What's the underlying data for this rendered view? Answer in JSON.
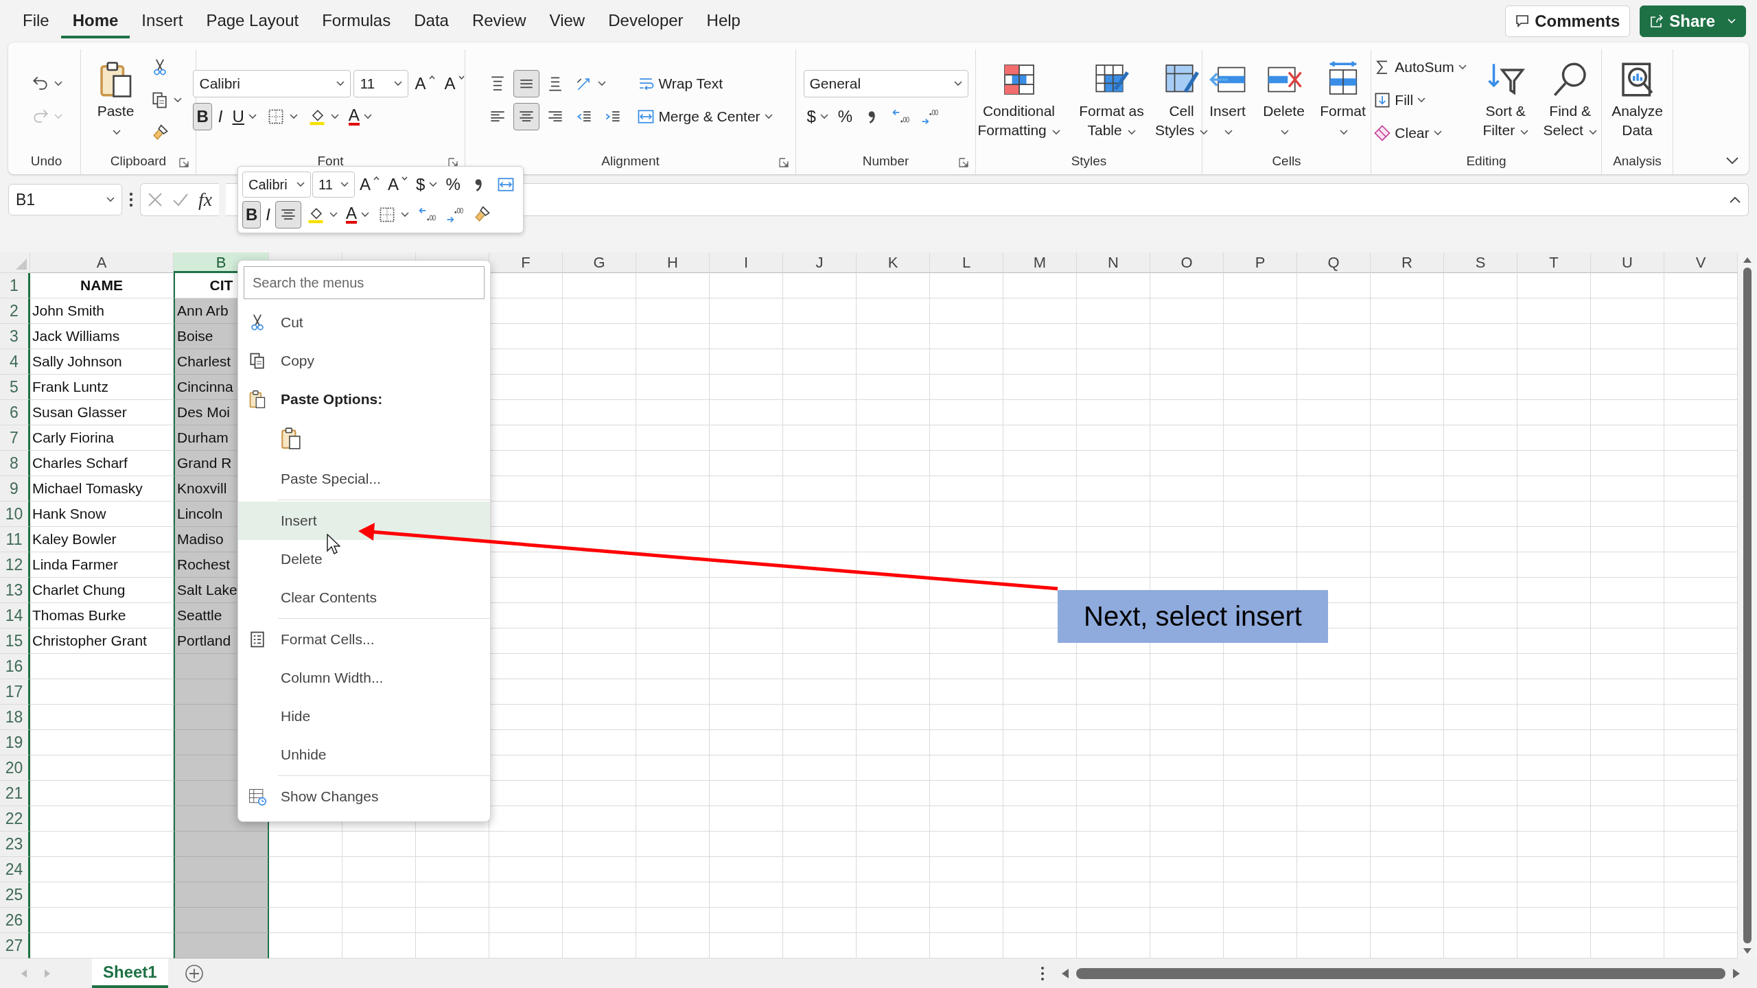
{
  "menu_tabs": [
    {
      "label": "File",
      "selected": false
    },
    {
      "label": "Home",
      "selected": true
    },
    {
      "label": "Insert",
      "selected": false
    },
    {
      "label": "Page Layout",
      "selected": false
    },
    {
      "label": "Formulas",
      "selected": false
    },
    {
      "label": "Data",
      "selected": false
    },
    {
      "label": "Review",
      "selected": false
    },
    {
      "label": "View",
      "selected": false
    },
    {
      "label": "Developer",
      "selected": false
    },
    {
      "label": "Help",
      "selected": false
    }
  ],
  "comments_button": {
    "label": "Comments"
  },
  "share_button": {
    "label": "Share"
  },
  "ribbon": {
    "groups": [
      {
        "label": "Undo",
        "launcher": false,
        "sections": [
          {
            "lines": [
              [
                {
                  "kind": "undo",
                  "caret": true,
                  "disabled": false
                }
              ],
              [
                {
                  "kind": "redo",
                  "caret": true,
                  "disabled": true
                }
              ]
            ]
          }
        ]
      },
      {
        "label": "Clipboard",
        "launcher": true,
        "sections": [
          {
            "lines": [
              [
                {
                  "kind": "paste",
                  "label": "Paste",
                  "caret": true
                }
              ]
            ]
          },
          {
            "lines": [
              [
                {
                  "kind": "cut",
                  "caret": false
                }
              ],
              [
                {
                  "kind": "copy",
                  "caret": true
                }
              ],
              [
                {
                  "kind": "painter",
                  "caret": false
                }
              ]
            ]
          }
        ]
      },
      {
        "label": "Font",
        "launcher": true,
        "sections": [
          {
            "lines": [
              [
                {
                  "kind": "font-box",
                  "value": "Calibri"
                },
                {
                  "kind": "size-box",
                  "value": "11"
                },
                {
                  "kind": "grow",
                  "text": "A",
                  "caret": false
                },
                {
                  "kind": "shrink",
                  "text": "A",
                  "caret": false
                }
              ],
              [
                {
                  "kind": "bold",
                  "text": "B",
                  "selected": true,
                  "caret": false
                },
                {
                  "kind": "italic",
                  "text": "I",
                  "selected": false,
                  "caret": false
                },
                {
                  "kind": "underline",
                  "text": "U",
                  "selected": false,
                  "caret": true
                },
                {
                  "kind": "borders",
                  "caret": true
                },
                {
                  "kind": "fill",
                  "caret": true
                },
                {
                  "kind": "fontcolor",
                  "text": "A",
                  "caret": true
                }
              ]
            ]
          }
        ]
      },
      {
        "label": "Alignment",
        "launcher": true,
        "sections": [
          {
            "lines": [
              [
                {
                  "kind": "align-top",
                  "selected": false,
                  "caret": false
                },
                {
                  "kind": "align-middle",
                  "selected": true,
                  "caret": false
                },
                {
                  "kind": "align-bottom",
                  "selected": false,
                  "caret": false
                },
                {
                  "kind": "orientation",
                  "caret": true
                }
              ],
              [
                {
                  "kind": "align-left",
                  "selected": false,
                  "caret": false
                },
                {
                  "kind": "align-center",
                  "selected": true,
                  "caret": false
                },
                {
                  "kind": "align-right",
                  "selected": false,
                  "caret": false
                },
                {
                  "kind": "outdent",
                  "caret": false
                },
                {
                  "kind": "indent",
                  "caret": false
                }
              ]
            ]
          },
          {
            "lines": [
              [
                {
                  "kind": "wrap",
                  "label": "Wrap Text",
                  "caret": false
                }
              ],
              [
                {
                  "kind": "merge",
                  "label": "Merge & Center",
                  "caret": true
                }
              ]
            ]
          }
        ]
      },
      {
        "label": "Number",
        "launcher": true,
        "sections": [
          {
            "lines": [
              [
                {
                  "kind": "format-box",
                  "value": "General"
                }
              ],
              [
                {
                  "kind": "currency",
                  "text": "$",
                  "caret": true
                },
                {
                  "kind": "percent",
                  "text": "%",
                  "caret": false
                },
                {
                  "kind": "comma",
                  "caret": false
                },
                {
                  "kind": "inc-decimal",
                  "caret": false
                },
                {
                  "kind": "dec-decimal",
                  "caret": false
                }
              ]
            ]
          }
        ]
      },
      {
        "label": "Styles",
        "launcher": false,
        "sections": [
          {
            "lines": [
              [
                {
                  "kind": "conditional",
                  "label": "Conditional Formatting",
                  "caret": true
                },
                {
                  "kind": "table",
                  "label": "Format as Table",
                  "caret": true
                },
                {
                  "kind": "cellstyles",
                  "label": "Cell Styles",
                  "caret": true
                }
              ]
            ]
          }
        ]
      },
      {
        "label": "Cells",
        "launcher": false,
        "sections": [
          {
            "lines": [
              [
                {
                  "kind": "insert-cells",
                  "label": "Insert",
                  "caret": true
                },
                {
                  "kind": "delete-cells",
                  "label": "Delete",
                  "caret": true
                },
                {
                  "kind": "format-cells",
                  "label": "Format",
                  "caret": true
                }
              ]
            ]
          }
        ]
      },
      {
        "label": "Editing",
        "launcher": false,
        "sections": [
          {
            "lines": [
              [
                {
                  "kind": "autosum",
                  "label": "AutoSum",
                  "caret": true
                }
              ],
              [
                {
                  "kind": "fill-down",
                  "label": "Fill",
                  "caret": true
                }
              ],
              [
                {
                  "kind": "clear",
                  "label": "Clear",
                  "caret": true
                }
              ]
            ]
          },
          {
            "lines": [
              [
                {
                  "kind": "sort",
                  "label": "Sort & Filter",
                  "caret": true
                },
                {
                  "kind": "find",
                  "label": "Find & Select",
                  "caret": true
                }
              ]
            ]
          }
        ]
      },
      {
        "label": "Analysis",
        "launcher": false,
        "sections": [
          {
            "lines": [
              [
                {
                  "kind": "analyze",
                  "label": "Analyze Data",
                  "caret": false
                }
              ]
            ]
          }
        ]
      }
    ]
  },
  "formula_bar": {
    "name_box": "B1",
    "fx": "fx"
  },
  "mini_toolbar": {
    "lines": [
      [
        {
          "kind": "font-box",
          "value": "Calibri"
        },
        {
          "kind": "size-box",
          "value": "11"
        },
        {
          "kind": "grow",
          "text": "A",
          "caret": false
        },
        {
          "kind": "shrink",
          "text": "A",
          "caret": false
        },
        {
          "kind": "currency",
          "text": "$",
          "caret": true
        },
        {
          "kind": "percent",
          "text": "%",
          "caret": false
        },
        {
          "kind": "comma",
          "caret": false
        },
        {
          "kind": "merge",
          "caret": false
        }
      ],
      [
        {
          "kind": "bold",
          "text": "B",
          "selected": true,
          "caret": false
        },
        {
          "kind": "italic",
          "text": "I",
          "selected": false,
          "caret": false
        },
        {
          "kind": "align-center",
          "selected": true,
          "caret": false
        },
        {
          "kind": "fill",
          "caret": true
        },
        {
          "kind": "fontcolor",
          "text": "A",
          "caret": true
        },
        {
          "kind": "borders",
          "caret": true
        },
        {
          "kind": "inc-decimal",
          "caret": false
        },
        {
          "kind": "dec-decimal",
          "caret": false
        },
        {
          "kind": "painter",
          "caret": false
        }
      ]
    ]
  },
  "sheet": {
    "columns": [
      {
        "label": "A",
        "selected": false,
        "covered": false
      },
      {
        "label": "B",
        "selected": true,
        "covered": false
      },
      {
        "selected": false,
        "covered": true
      },
      {
        "selected": false,
        "covered": true
      },
      {
        "selected": false,
        "covered": true
      },
      {
        "label": "F",
        "selected": false,
        "covered": false
      },
      {
        "label": "G",
        "selected": false,
        "covered": false
      },
      {
        "label": "H",
        "selected": false,
        "covered": false
      },
      {
        "label": "I",
        "selected": false,
        "covered": false
      },
      {
        "label": "J",
        "selected": false,
        "covered": false
      },
      {
        "label": "K",
        "selected": false,
        "covered": false
      },
      {
        "label": "L",
        "selected": false,
        "covered": false
      },
      {
        "label": "M",
        "selected": false,
        "covered": false
      },
      {
        "label": "N",
        "selected": false,
        "covered": false
      },
      {
        "label": "O",
        "selected": false,
        "covered": false
      },
      {
        "label": "P",
        "selected": false,
        "covered": false
      },
      {
        "label": "Q",
        "selected": false,
        "covered": false
      },
      {
        "label": "R",
        "selected": false,
        "covered": false
      },
      {
        "label": "S",
        "selected": false,
        "covered": false
      },
      {
        "label": "T",
        "selected": false,
        "covered": false
      },
      {
        "label": "U",
        "selected": false,
        "covered": false
      },
      {
        "label": "V",
        "selected": false,
        "covered": false
      }
    ],
    "rows": [
      {
        "number": "1",
        "bold": true,
        "cells": [
          "NAME",
          "CIT"
        ]
      },
      {
        "number": "2",
        "bold": false,
        "cells": [
          "John Smith",
          "Ann Arb"
        ]
      },
      {
        "number": "3",
        "bold": false,
        "cells": [
          "Jack Williams",
          "Boise"
        ]
      },
      {
        "number": "4",
        "bold": false,
        "cells": [
          "Sally Johnson",
          "Charlest"
        ]
      },
      {
        "number": "5",
        "bold": false,
        "cells": [
          "Frank Luntz",
          "Cincinna"
        ]
      },
      {
        "number": "6",
        "bold": false,
        "cells": [
          "Susan Glasser",
          "Des Moi"
        ]
      },
      {
        "number": "7",
        "bold": false,
        "cells": [
          "Carly Fiorina",
          "Durham"
        ]
      },
      {
        "number": "8",
        "bold": false,
        "cells": [
          "Charles Scharf",
          "Grand R"
        ]
      },
      {
        "number": "9",
        "bold": false,
        "cells": [
          "Michael Tomasky",
          "Knoxvill"
        ]
      },
      {
        "number": "10",
        "bold": false,
        "cells": [
          "Hank Snow",
          "Lincoln"
        ]
      },
      {
        "number": "11",
        "bold": false,
        "cells": [
          "Kaley Bowler",
          "Madiso"
        ]
      },
      {
        "number": "12",
        "bold": false,
        "cells": [
          "Linda Farmer",
          "Rochest"
        ]
      },
      {
        "number": "13",
        "bold": false,
        "cells": [
          "Charlet Chung",
          "Salt Lake"
        ]
      },
      {
        "number": "14",
        "bold": false,
        "cells": [
          "Thomas Burke",
          "Seattle"
        ]
      },
      {
        "number": "15",
        "bold": false,
        "cells": [
          "Christopher Grant",
          "Portland"
        ]
      },
      {
        "number": "16"
      },
      {
        "number": "17"
      },
      {
        "number": "18"
      },
      {
        "number": "19"
      },
      {
        "number": "20"
      },
      {
        "number": "21"
      },
      {
        "number": "22"
      },
      {
        "number": "23"
      },
      {
        "number": "24"
      },
      {
        "number": "25"
      },
      {
        "number": "26"
      },
      {
        "number": "27"
      }
    ]
  },
  "context_menu": {
    "search_placeholder": "Search the menus",
    "items": [
      {
        "kind": "cut",
        "label": "Cut",
        "highlighted": false
      },
      {
        "kind": "copy",
        "label": "Copy",
        "highlighted": false
      },
      {
        "kind": "paste-header",
        "label": "Paste Options:",
        "highlighted": false
      },
      {
        "kind": "paste-option"
      },
      {
        "kind": "command",
        "label": "Paste Special...",
        "highlighted": false
      },
      {
        "kind": "separator"
      },
      {
        "kind": "command",
        "label": "Insert",
        "highlighted": true
      },
      {
        "kind": "command",
        "label": "Delete",
        "highlighted": false
      },
      {
        "kind": "command",
        "label": "Clear Contents",
        "highlighted": false
      },
      {
        "kind": "separator"
      },
      {
        "kind": "format-cells",
        "label": "Format Cells...",
        "highlighted": false
      },
      {
        "kind": "command",
        "label": "Column Width...",
        "highlighted": false
      },
      {
        "kind": "command",
        "label": "Hide",
        "highlighted": false
      },
      {
        "kind": "command",
        "label": "Unhide",
        "highlighted": false
      },
      {
        "kind": "separator"
      },
      {
        "kind": "show-changes",
        "label": "Show Changes",
        "highlighted": false
      }
    ]
  },
  "sheet_tabs": [
    {
      "label": "Sheet1",
      "selected": true
    }
  ],
  "callout": {
    "text": "Next, select insert"
  }
}
